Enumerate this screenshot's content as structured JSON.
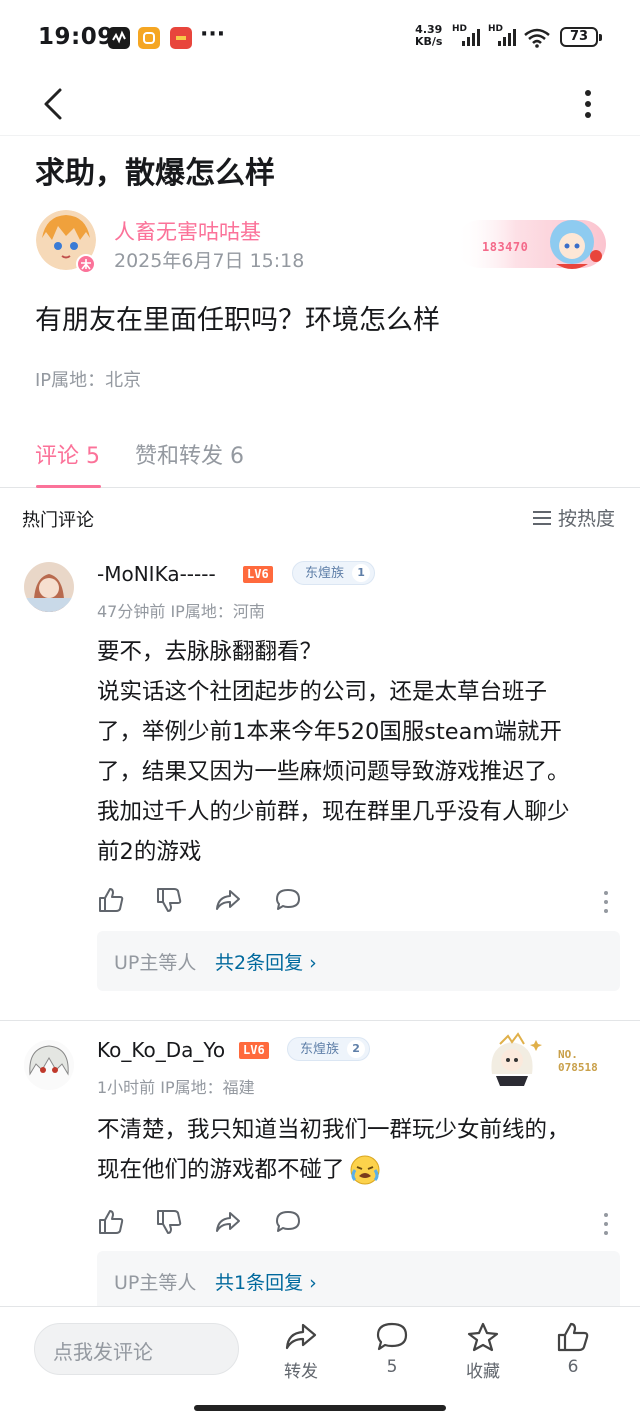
{
  "status_bar": {
    "time": "19:09",
    "speed_value": "4.39",
    "speed_unit": "KB/s",
    "hd1": "HD",
    "hd2": "HD",
    "battery": "73",
    "more": "···"
  },
  "post": {
    "title": "求助，散爆怎么样",
    "author": "人畜无害咕咕基",
    "date": "2025年6月7日 15:18",
    "fan_badge_number": "183470",
    "body": "有朋友在里面任职吗？环境怎么样",
    "ip": "IP属地：北京"
  },
  "tabs": [
    {
      "label": "评论 5"
    },
    {
      "label": "赞和转发 6"
    }
  ],
  "comments_header": {
    "title": "热门评论",
    "sort_label": "按热度"
  },
  "comments": [
    {
      "user": "-MoNIKa-----",
      "level": "LV6",
      "medal_name": "东煌族",
      "medal_level": "1",
      "meta": "47分钟前 IP属地：河南",
      "lines": [
        "要不，去脉脉翻翻看？",
        "说实话这个社团起步的公司，还是太草台班子",
        "了，举例少前1本来今年520国服steam端就开",
        "了，结果又因为一些麻烦问题导致游戏推迟了。",
        "我加过千人的少前群，现在群里几乎没有人聊少",
        "前2的游戏"
      ],
      "reply_up": "UP主等人",
      "reply_count": "共2条回复 ›"
    },
    {
      "user": "Ko_Ko_Da_Yo",
      "level": "LV6",
      "medal_name": "东煌族",
      "medal_level": "2",
      "card_no_label": "NO.",
      "card_no": "078518",
      "meta": "1小时前 IP属地：福建",
      "lines": [
        "不清楚，我只知道当初我们一群玩少女前线的，",
        "现在他们的游戏都不碰了"
      ],
      "reply_up": "UP主等人",
      "reply_count": "共1条回复 ›"
    }
  ],
  "bottom_bar": {
    "input_placeholder": "点我发评论",
    "share_label": "转发",
    "comment_count": "5",
    "favorite_label": "收藏",
    "like_count": "6"
  },
  "colors": {
    "accent": "#fb7299",
    "link": "#00699d",
    "level_badge": "#ff6a3d",
    "muted": "#9499a0"
  }
}
